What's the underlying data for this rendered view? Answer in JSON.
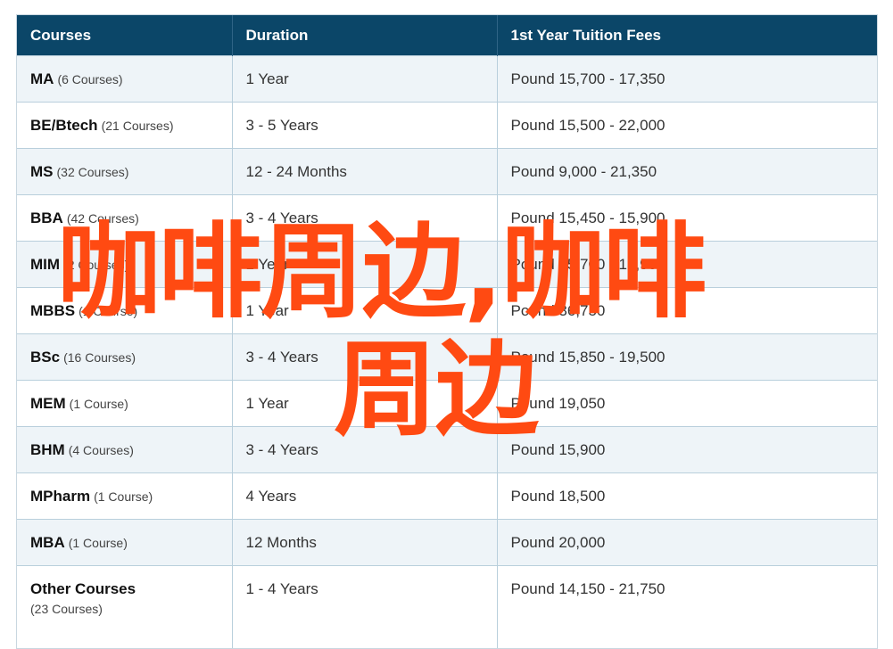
{
  "table": {
    "headers": [
      "Courses",
      "Duration",
      "1st Year Tuition Fees"
    ],
    "rows": [
      {
        "course": "MA",
        "count": "(6 Courses)",
        "duration": "1 Year",
        "fees": "Pound 15,700 - 17,350"
      },
      {
        "course": "BE/Btech",
        "count": "(21 Courses)",
        "duration": "3 - 5 Years",
        "fees": "Pound 15,500 - 22,000"
      },
      {
        "course": "MS",
        "count": "(32 Courses)",
        "duration": "12 - 24 Months",
        "fees": "Pound 9,000 - 21,350"
      },
      {
        "course": "BBA",
        "count": "(42 Courses)",
        "duration": "3 - 4 Years",
        "fees": "Pound 15,450 - 15,900"
      },
      {
        "course": "MIM",
        "count": "(2 Courses)",
        "duration": "1 Year",
        "fees": "Pound 15,700 - 18,900"
      },
      {
        "course": "MBBS",
        "count": "(1 Course)",
        "duration": "1 Year",
        "fees": "Pound 36,750"
      },
      {
        "course": "BSc",
        "count": "(16 Courses)",
        "duration": "3 - 4 Years",
        "fees": "Pound 15,850 - 19,500"
      },
      {
        "course": "MEM",
        "count": "(1 Course)",
        "duration": "1 Year",
        "fees": "Pound 19,050"
      },
      {
        "course": "BHM",
        "count": "(4 Courses)",
        "duration": "3 - 4 Years",
        "fees": "Pound 15,900"
      },
      {
        "course": "MPharm",
        "count": "(1 Course)",
        "duration": "4 Years",
        "fees": "Pound 18,500"
      },
      {
        "course": "MBA",
        "count": "(1 Course)",
        "duration": "12 Months",
        "fees": "Pound 20,000"
      },
      {
        "course": "Other Courses",
        "count": "(23 Courses)",
        "duration": "1 - 4 Years",
        "fees": "Pound 14,150 - 21,750"
      }
    ]
  },
  "overlay": {
    "line1": "咖啡周边,咖啡",
    "line2": "周边",
    "color": "#ff4a12"
  },
  "colors": {
    "header_bg": "#0b4668",
    "row_alt_bg": "#eef4f8",
    "border": "#b9cfdc"
  }
}
